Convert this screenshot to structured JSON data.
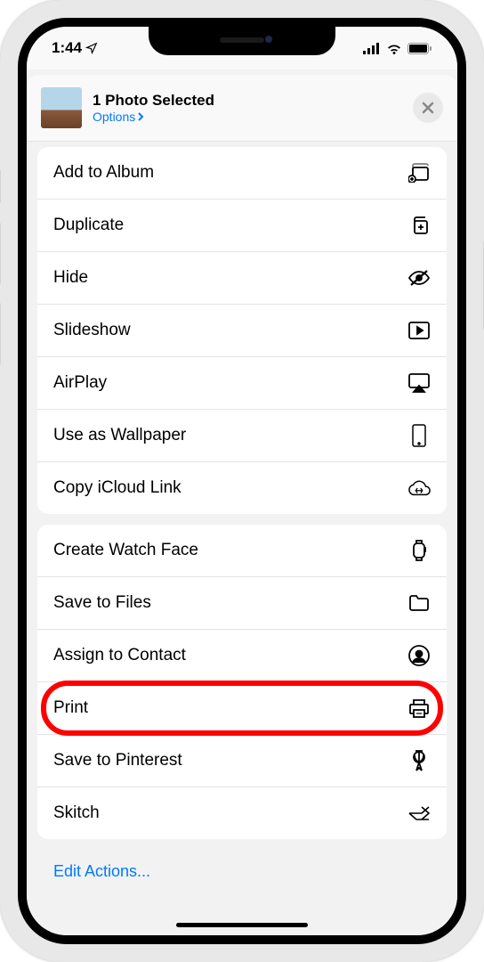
{
  "status": {
    "time": "1:44",
    "location_glyph": "✈"
  },
  "header": {
    "title": "1 Photo Selected",
    "options_label": "Options"
  },
  "groups": [
    {
      "actions": [
        {
          "label": "Add to Album",
          "icon": "album-add-icon"
        },
        {
          "label": "Duplicate",
          "icon": "duplicate-icon"
        },
        {
          "label": "Hide",
          "icon": "hide-icon"
        },
        {
          "label": "Slideshow",
          "icon": "play-icon"
        },
        {
          "label": "AirPlay",
          "icon": "airplay-icon"
        },
        {
          "label": "Use as Wallpaper",
          "icon": "wallpaper-icon"
        },
        {
          "label": "Copy iCloud Link",
          "icon": "icloud-link-icon"
        }
      ]
    },
    {
      "actions": [
        {
          "label": "Create Watch Face",
          "icon": "watch-icon"
        },
        {
          "label": "Save to Files",
          "icon": "folder-icon"
        },
        {
          "label": "Assign to Contact",
          "icon": "contact-icon"
        },
        {
          "label": "Print",
          "icon": "printer-icon",
          "highlighted": true
        },
        {
          "label": "Save to Pinterest",
          "icon": "pin-icon"
        },
        {
          "label": "Skitch",
          "icon": "skitch-icon"
        }
      ]
    }
  ],
  "footer": {
    "edit_actions": "Edit Actions..."
  }
}
